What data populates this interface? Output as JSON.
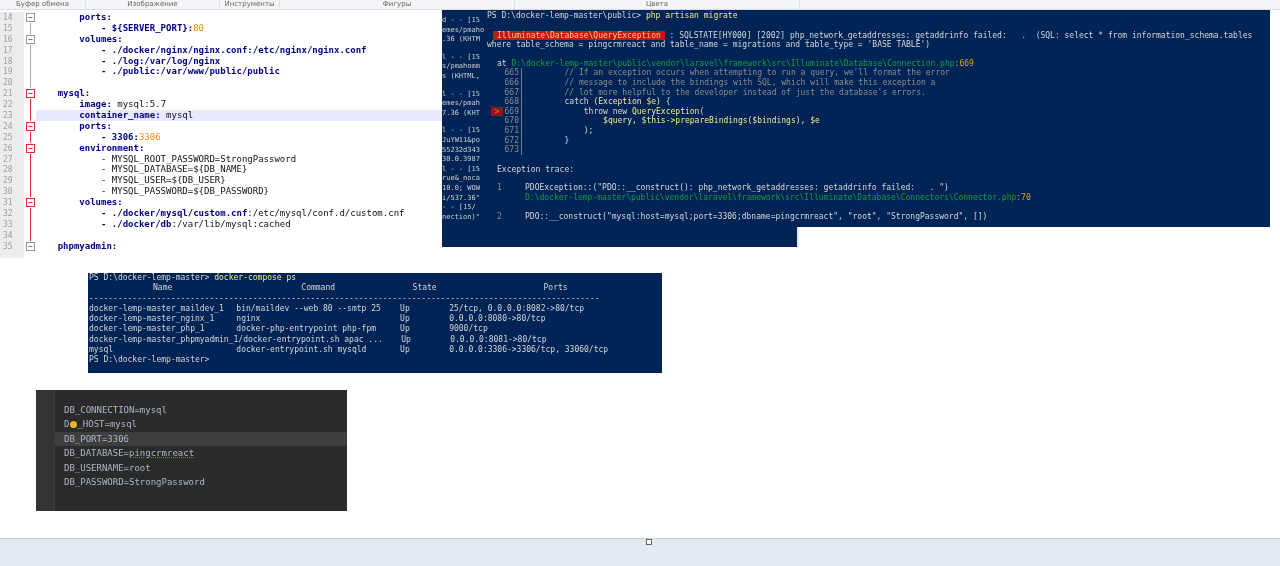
{
  "ribbon": {
    "groups": [
      "Буфер обмена",
      "Изображение",
      "Инструменты",
      "Фигуры",
      "Цвета"
    ]
  },
  "yaml_editor": {
    "lines": [
      {
        "number": "14",
        "fold_start": true,
        "in_active_block": false,
        "highlight": false,
        "segments": [
          {
            "kind": "key",
            "text": "        ports:"
          }
        ]
      },
      {
        "number": "15",
        "fold_start": false,
        "in_active_block": false,
        "highlight": false,
        "segments": [
          {
            "kind": "key",
            "text": "            - ${SERVER_PORT}:"
          },
          {
            "kind": "number",
            "text": "80"
          }
        ]
      },
      {
        "number": "16",
        "fold_start": true,
        "in_active_block": false,
        "highlight": false,
        "segments": [
          {
            "kind": "key",
            "text": "        volumes:"
          }
        ]
      },
      {
        "number": "17",
        "fold_start": false,
        "in_active_block": false,
        "highlight": false,
        "segments": [
          {
            "kind": "key",
            "text": "            - ./docker/nginx/nginx.conf:/etc/nginx/nginx.conf"
          }
        ]
      },
      {
        "number": "18",
        "fold_start": false,
        "in_active_block": false,
        "highlight": false,
        "segments": [
          {
            "kind": "key",
            "text": "            - ./log:/var/log/nginx"
          }
        ]
      },
      {
        "number": "19",
        "fold_start": false,
        "in_active_block": false,
        "highlight": false,
        "segments": [
          {
            "kind": "key",
            "text": "            - ./public:/var/www/public/public"
          }
        ]
      },
      {
        "number": "20",
        "fold_start": false,
        "in_active_block": false,
        "highlight": false
      },
      {
        "number": "21",
        "fold_start": true,
        "in_active_block": true,
        "highlight": false,
        "segments": [
          {
            "kind": "key",
            "text": "    mysql:"
          }
        ]
      },
      {
        "number": "22",
        "fold_start": false,
        "in_active_block": true,
        "highlight": false,
        "segments": [
          {
            "kind": "key",
            "text": "        image:"
          },
          {
            "kind": "value",
            "text": " mysql:5.7"
          }
        ]
      },
      {
        "number": "23",
        "fold_start": false,
        "in_active_block": true,
        "highlight": true,
        "segments": [
          {
            "kind": "key",
            "text": "        container_name:"
          },
          {
            "kind": "value",
            "text": " mysql"
          }
        ]
      },
      {
        "number": "24",
        "fold_start": true,
        "in_active_block": true,
        "highlight": false,
        "segments": [
          {
            "kind": "key",
            "text": "        ports:"
          }
        ]
      },
      {
        "number": "25",
        "fold_start": false,
        "in_active_block": true,
        "highlight": false,
        "segments": [
          {
            "kind": "key",
            "text": "            - 3306:"
          },
          {
            "kind": "number",
            "text": "3306"
          }
        ]
      },
      {
        "number": "26",
        "fold_start": true,
        "in_active_block": true,
        "highlight": false,
        "segments": [
          {
            "kind": "key",
            "text": "        environment:"
          }
        ]
      },
      {
        "number": "27",
        "fold_start": false,
        "in_active_block": true,
        "highlight": false,
        "segments": [
          {
            "kind": "value",
            "text": "            - MYSQL_ROOT_PASSWORD=StrongPassword"
          }
        ]
      },
      {
        "number": "28",
        "fold_start": false,
        "in_active_block": true,
        "highlight": false,
        "segments": [
          {
            "kind": "value",
            "text": "            - MYSQL_DATABASE=${DB_NAME}"
          }
        ]
      },
      {
        "number": "29",
        "fold_start": false,
        "in_active_block": true,
        "highlight": false,
        "segments": [
          {
            "kind": "value",
            "text": "            - MYSQL_USER=${DB_USER}"
          }
        ]
      },
      {
        "number": "30",
        "fold_start": false,
        "in_active_block": true,
        "highlight": false,
        "segments": [
          {
            "kind": "value",
            "text": "            - MYSQL_PASSWORD=${DB_PASSWORD}"
          }
        ]
      },
      {
        "number": "31",
        "fold_start": true,
        "in_active_block": true,
        "highlight": false,
        "segments": [
          {
            "kind": "key",
            "text": "        volumes:"
          }
        ]
      },
      {
        "number": "32",
        "fold_start": false,
        "in_active_block": true,
        "highlight": false,
        "segments": [
          {
            "kind": "key",
            "text": "            - ./docker/mysql/custom.cnf"
          },
          {
            "kind": "value",
            "text": ":/etc/mysql/conf.d/custom.cnf"
          }
        ]
      },
      {
        "number": "33",
        "fold_start": false,
        "in_active_block": true,
        "highlight": false,
        "segments": [
          {
            "kind": "key",
            "text": "            - ./docker/db"
          },
          {
            "kind": "value",
            "text": ":/var/lib/mysql:cached"
          }
        ]
      },
      {
        "number": "34",
        "fold_start": false,
        "in_active_block": true,
        "highlight": false
      },
      {
        "number": "35",
        "fold_start": true,
        "in_active_block": false,
        "highlight": false,
        "segments": [
          {
            "kind": "key",
            "text": "    phpmyadmin:"
          }
        ]
      }
    ]
  },
  "background_log": {
    "entries": [
      [
        "d - - [15",
        "emes/pmaho",
        ".36 (KHTM"
      ],
      [
        "l - - [15",
        "s/pmahomm",
        "s (KHTML,"
      ],
      [
        "l - - [15",
        "emes/pmah",
        "7.36 (KHT"
      ],
      [
        "l - - [15",
        "JuYW11&po",
        "55232d343",
        "30.0.3987",
        "l - - [15",
        "rue&_noca",
        "10.0; WOW",
        "i/537.36\"",
        "- - [15/",
        "nection)\""
      ]
    ]
  },
  "migrate_terminal": {
    "prompt": "PS D:\\docker-lemp-master\\public>",
    "command": "php artisan migrate",
    "exception_class": "Illuminate\\Database\\QueryException",
    "message": " : SQLSTATE[HY000] [2002] php_network_getaddresses: getaddrinfo failed:   .  (SQL: select * from information_schema.tables",
    "message_continued": "where table_schema = pingcrmreact and table_name = migrations and table_type = 'BASE TABLE')",
    "at_label": "at",
    "location_path": "D:\\docker-lemp-master\\public\\vendor\\laravel\\framework\\src\\Illuminate\\Database\\Connection.php",
    "location_line": ":669",
    "code": [
      {
        "number": "665",
        "current": false,
        "segments": [
          {
            "kind": "comment",
            "text": "        // If an exception occurs when attempting to run a query, we'll format the error"
          }
        ]
      },
      {
        "number": "666",
        "current": false,
        "segments": [
          {
            "kind": "comment",
            "text": "        // message to include the bindings with SQL, which will make this exception a"
          }
        ]
      },
      {
        "number": "667",
        "current": false,
        "segments": [
          {
            "kind": "comment",
            "text": "        // lot more helpful to the developer instead of just the database's errors."
          }
        ]
      },
      {
        "number": "668",
        "current": false,
        "segments": [
          {
            "kind": "plain",
            "text": "        catch "
          },
          {
            "kind": "accent",
            "text": "(Exception $e)"
          },
          {
            "kind": "plain",
            "text": " {"
          }
        ]
      },
      {
        "number": "669",
        "current": true,
        "marker": ">",
        "segments": [
          {
            "kind": "plain",
            "text": "            throw new "
          },
          {
            "kind": "accent",
            "text": "QueryException"
          },
          {
            "kind": "plain",
            "text": "("
          }
        ]
      },
      {
        "number": "670",
        "current": false,
        "segments": [
          {
            "kind": "accent",
            "text": "                $query, $this->prepareBindings($bindings), $e"
          }
        ]
      },
      {
        "number": "671",
        "current": false,
        "segments": [
          {
            "kind": "plain",
            "text": "            );"
          }
        ]
      },
      {
        "number": "672",
        "current": false,
        "segments": [
          {
            "kind": "plain",
            "text": "        }"
          }
        ]
      },
      {
        "number": "673",
        "current": false
      }
    ],
    "trace_title": "Exception trace:",
    "trace": [
      {
        "index": "1",
        "call": "PDOException::(\"PDO::__construct(): php_network_getaddresses: getaddrinfo failed:   . \")",
        "path": "D:\\docker-lemp-master\\public\\vendor\\laravel\\framework\\src\\Illuminate\\Database\\Connectors\\Connector.php",
        "line": ":70"
      },
      {
        "index": "2",
        "call": "PDO::__construct(\"mysql:host=mysql;port=3306;dbname=pingcrmreact\", \"root\", \"StrongPassword\", [])"
      }
    ]
  },
  "compose_terminal": {
    "prompt": "PS D:\\docker-lemp-master>",
    "command": "docker-compose ps",
    "columns": [
      "Name",
      "Command",
      "State",
      "Ports"
    ],
    "rule": "----------------------------------------------------------------------------------------------------------",
    "rows": [
      [
        "docker-lemp-master_maildev_1",
        "bin/maildev --web 80 --smtp 25",
        "Up",
        "25/tcp, 0.0.0.0:8082->80/tcp"
      ],
      [
        "docker-lemp-master_nginx_1",
        "nginx",
        "Up",
        "0.0.0.0:8080->80/tcp"
      ],
      [
        "docker-lemp-master_php_1",
        "docker-php-entrypoint php-fpm",
        "Up",
        "9000/tcp"
      ],
      [
        "docker-lemp-master_phpmyadmin_1",
        "/docker-entrypoint.sh apac ...",
        "Up",
        "0.0.0.0:8081->80/tcp"
      ],
      [
        "mysql",
        "docker-entrypoint.sh mysqld",
        "Up",
        "0.0.0.0:3306->3306/tcp, 33060/tcp"
      ]
    ],
    "final_prompt": "PS D:\\docker-lemp-master>"
  },
  "env_editor": {
    "lines": [
      {
        "current": false,
        "segments": [
          {
            "kind": "text",
            "text": "DB_CONNECTION=mysql",
            "typo": false
          }
        ]
      },
      {
        "current": false,
        "segments": [
          {
            "kind": "text",
            "text": "D",
            "typo": false
          },
          {
            "kind": "bulb"
          },
          {
            "kind": "text",
            "text": "_HOST=mysql",
            "typo": false
          }
        ]
      },
      {
        "current": true,
        "segments": [
          {
            "kind": "text",
            "text": "DB_PORT=3306",
            "typo": false
          }
        ]
      },
      {
        "current": false,
        "segments": [
          {
            "kind": "text",
            "text": "DB_DATABASE=",
            "typo": false
          },
          {
            "kind": "text",
            "text": "pingcrmreact",
            "typo": true
          }
        ]
      },
      {
        "current": false,
        "segments": [
          {
            "kind": "text",
            "text": "DB_USERNAME=root",
            "typo": false
          }
        ]
      },
      {
        "current": false,
        "segments": [
          {
            "kind": "text",
            "text": "DB_PASSWORD=StrongPassword",
            "typo": false
          }
        ]
      }
    ]
  }
}
